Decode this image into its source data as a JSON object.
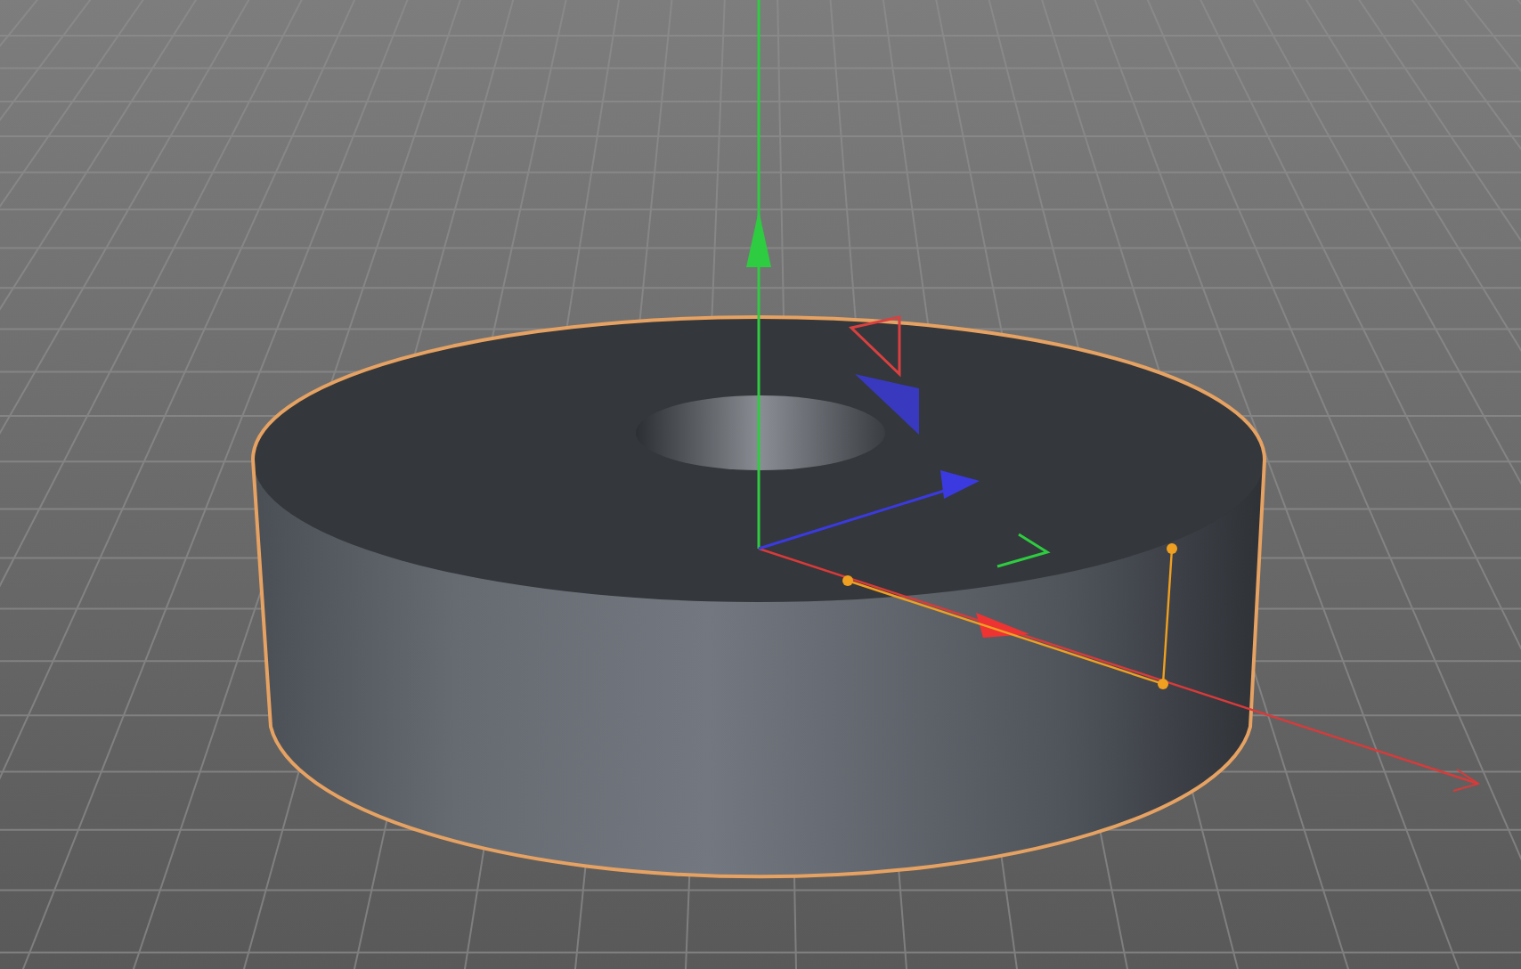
{
  "object": {
    "selected": true
  }
}
